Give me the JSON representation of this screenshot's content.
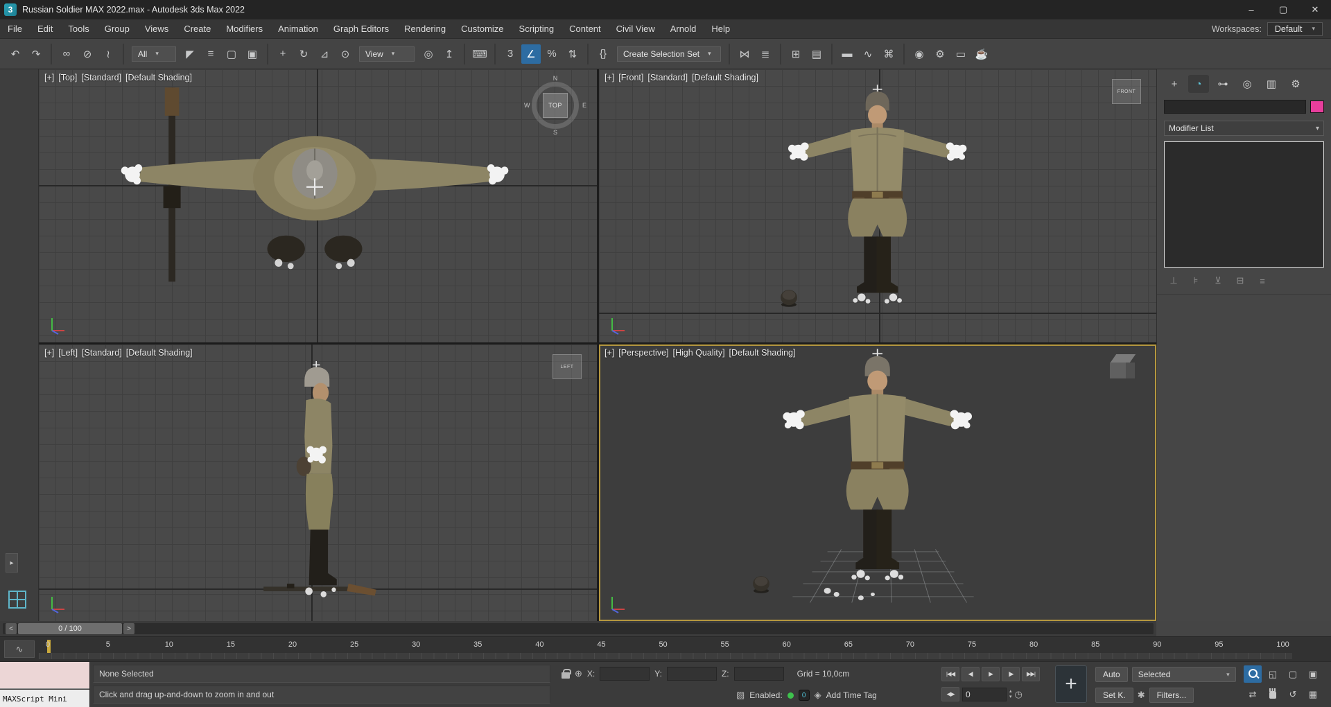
{
  "colors": {
    "active_viewport_border": "#b5973f",
    "active_tool_highlight": "#2d6ca2",
    "object_color_swatch": "#e83e9c",
    "enabled_dot": "#3ec14d",
    "layout_tab_icon": "#5fb6ca"
  },
  "titlebar": {
    "app_icon_text": "3",
    "title": "Russian Soldier MAX 2022.max - Autodesk 3ds Max 2022",
    "minimize": "–",
    "maximize": "▢",
    "close": "✕"
  },
  "menubar": {
    "items": [
      "File",
      "Edit",
      "Tools",
      "Group",
      "Views",
      "Create",
      "Modifiers",
      "Animation",
      "Graph Editors",
      "Rendering",
      "Customize",
      "Scripting",
      "Content",
      "Civil View",
      "Arnold",
      "Help"
    ],
    "workspaces_label": "Workspaces:",
    "workspaces_value": "Default",
    "workspaces_arrow": "▾"
  },
  "toolbar": {
    "group1": [
      {
        "name": "undo-button",
        "glyph": "↶",
        "state": "normal",
        "i": "true"
      },
      {
        "name": "redo-button",
        "glyph": "↷",
        "state": "normal",
        "i": "true"
      },
      {
        "name": "toolbar-separator",
        "glyph": "",
        "state": "sep",
        "i": "false"
      },
      {
        "name": "select-and-link-button",
        "glyph": "∞",
        "state": "normal",
        "i": "true"
      },
      {
        "name": "unlink-selection-button",
        "glyph": "⊘",
        "state": "normal",
        "i": "true"
      },
      {
        "name": "bind-to-space-warp-button",
        "glyph": "≀",
        "state": "normal",
        "i": "true"
      },
      {
        "name": "toolbar-separator",
        "glyph": "",
        "state": "sep",
        "i": "false"
      }
    ],
    "selection_filter_value": "All",
    "dropdown_arrow": "▾",
    "group2": [
      {
        "name": "select-object-button",
        "glyph": "◤",
        "state": "normal",
        "i": "true"
      },
      {
        "name": "select-by-name-button",
        "glyph": "≡",
        "state": "normal",
        "i": "true"
      },
      {
        "name": "rectangular-selection-region-button",
        "glyph": "▢",
        "state": "normal",
        "i": "true"
      },
      {
        "name": "window-crossing-toggle",
        "glyph": "▣",
        "state": "normal",
        "i": "true"
      },
      {
        "name": "toolbar-separator",
        "glyph": "",
        "state": "sep",
        "i": "false"
      },
      {
        "name": "select-and-move-button",
        "glyph": "+",
        "state": "normal",
        "i": "true"
      },
      {
        "name": "select-and-rotate-button",
        "glyph": "↻",
        "state": "normal",
        "i": "true"
      },
      {
        "name": "select-and-scale-button",
        "glyph": "⊿",
        "state": "normal",
        "i": "true"
      },
      {
        "name": "select-and-place-button",
        "glyph": "⊙",
        "state": "normal",
        "i": "true"
      }
    ],
    "coord_system_value": "View",
    "group3": [
      {
        "name": "use-pivot-point-button",
        "glyph": "◎",
        "state": "normal",
        "i": "true"
      },
      {
        "name": "select-and-manipulate-button",
        "glyph": "↥",
        "state": "normal",
        "i": "true"
      },
      {
        "name": "toolbar-separator",
        "glyph": "",
        "state": "sep",
        "i": "false"
      },
      {
        "name": "keyboard-shortcut-override-toggle",
        "glyph": "⌨",
        "state": "normal",
        "i": "true"
      },
      {
        "name": "toolbar-separator",
        "glyph": "",
        "state": "sep",
        "i": "false"
      },
      {
        "name": "snaps-toggle-3d",
        "glyph": "3",
        "state": "normal",
        "i": "true"
      },
      {
        "name": "angle-snap-toggle",
        "glyph": "∠",
        "state": "active",
        "i": "true"
      },
      {
        "name": "percent-snap-toggle",
        "glyph": "%",
        "state": "normal",
        "i": "true"
      },
      {
        "name": "spinner-snap-toggle",
        "glyph": "⇅",
        "state": "normal",
        "i": "true"
      },
      {
        "name": "toolbar-separator",
        "glyph": "",
        "state": "sep",
        "i": "false"
      },
      {
        "name": "edit-named-selection-sets-button",
        "glyph": "{}",
        "state": "normal",
        "i": "true"
      }
    ],
    "selection_set_value": "Create Selection Set",
    "group4": [
      {
        "name": "toolbar-separator",
        "glyph": "",
        "state": "sep",
        "i": "false"
      },
      {
        "name": "mirror-button",
        "glyph": "⋈",
        "state": "normal",
        "i": "true"
      },
      {
        "name": "align-button",
        "glyph": "≣",
        "state": "normal",
        "i": "true"
      },
      {
        "name": "toolbar-separator",
        "glyph": "",
        "state": "sep",
        "i": "false"
      },
      {
        "name": "toggle-scene-explorer-button",
        "glyph": "⊞",
        "state": "normal",
        "i": "true"
      },
      {
        "name": "toggle-layer-explorer-button",
        "glyph": "▤",
        "state": "normal",
        "i": "true"
      },
      {
        "name": "toolbar-separator",
        "glyph": "",
        "state": "sep",
        "i": "false"
      },
      {
        "name": "toggle-ribbon-button",
        "glyph": "▬",
        "state": "normal",
        "i": "true"
      },
      {
        "name": "curve-editor-button",
        "glyph": "∿",
        "state": "normal",
        "i": "true"
      },
      {
        "name": "schematic-view-button",
        "glyph": "⌘",
        "state": "normal",
        "i": "true"
      },
      {
        "name": "toolbar-separator",
        "glyph": "",
        "state": "sep",
        "i": "false"
      },
      {
        "name": "material-editor-button",
        "glyph": "◉",
        "state": "normal",
        "i": "true"
      },
      {
        "name": "render-setup-button",
        "glyph": "⚙",
        "state": "normal",
        "i": "true"
      },
      {
        "name": "rendered-frame-window-button",
        "glyph": "▭",
        "state": "normal",
        "i": "true"
      },
      {
        "name": "render-production-button",
        "glyph": "☕",
        "state": "normal",
        "i": "true"
      }
    ]
  },
  "left_strip": {
    "expand_arrow": "▸"
  },
  "viewports": {
    "top": {
      "menus": [
        "[+]",
        "[Top]",
        "[Standard]",
        "[Default Shading]"
      ],
      "viewcube": {
        "face": "TOP",
        "n": "N",
        "s": "S",
        "w": "W",
        "e": "E"
      }
    },
    "front": {
      "menus": [
        "[+]",
        "[Front]",
        "[Standard]",
        "[Default Shading]"
      ],
      "viewcube_face": "FRONT"
    },
    "left": {
      "menus": [
        "[+]",
        "[Left]",
        "[Standard]",
        "[Default Shading]"
      ],
      "viewcube_face": "LEFT"
    },
    "perspective": {
      "menus": [
        "[+]",
        "[Perspective]",
        "[High Quality]",
        "[Default Shading]"
      ]
    }
  },
  "command_panel": {
    "tabs": [
      {
        "name": "tab-create",
        "glyph": "+",
        "state": "normal",
        "i": "true"
      },
      {
        "name": "tab-modify",
        "glyph": "◔",
        "state": "active",
        "i": "true"
      },
      {
        "name": "tab-hierarchy",
        "glyph": "⊶",
        "state": "normal",
        "i": "true"
      },
      {
        "name": "tab-motion",
        "glyph": "◎",
        "state": "normal",
        "i": "true"
      },
      {
        "name": "tab-display",
        "glyph": "▥",
        "state": "normal",
        "i": "true"
      },
      {
        "name": "tab-utilities",
        "glyph": "⚙",
        "state": "normal",
        "i": "true"
      }
    ],
    "object_name_value": "",
    "modifier_list_label": "Modifier List",
    "dropdown_arrow": "▾",
    "stack_buttons": [
      {
        "name": "pin-stack-button",
        "glyph": "⊥",
        "i": "true"
      },
      {
        "name": "show-end-result-button",
        "glyph": "⊧",
        "i": "true"
      },
      {
        "name": "make-unique-button",
        "glyph": "⊻",
        "i": "true"
      },
      {
        "name": "remove-modifier-button",
        "glyph": "⊟",
        "i": "true"
      },
      {
        "name": "configure-modifier-sets-button",
        "glyph": "≡",
        "i": "true"
      }
    ]
  },
  "timeline": {
    "slider_back": "<",
    "slider_forward": ">",
    "slider_label": "0 / 100",
    "mini_curve_glyph": "∿",
    "ticks": [
      "0",
      "5",
      "10",
      "15",
      "20",
      "25",
      "30",
      "35",
      "40",
      "45",
      "50",
      "55",
      "60",
      "65",
      "70",
      "75",
      "80",
      "85",
      "90",
      "95",
      "100"
    ]
  },
  "status_bar": {
    "maxscript_label": "MAXScript Mini",
    "status_line": "None Selected",
    "prompt_line": "Click and drag up-and-down to zoom in and out",
    "absolute_mode_glyph": "⊕",
    "x_label": "X:",
    "y_label": "Y:",
    "z_label": "Z:",
    "coord_x_value": "",
    "coord_y_value": "",
    "coord_z_value": "",
    "grid_text": "Grid = 10,0cm",
    "degradation_glyph": "▧",
    "enabled_label": "Enabled:",
    "zero_badge": "0",
    "time_tag_glyph": "◈",
    "add_time_tag_label": "Add Time Tag",
    "playback": [
      {
        "name": "go-to-start-button",
        "glyph": "|◀◀"
      },
      {
        "name": "previous-frame-button",
        "glyph": "◀|"
      },
      {
        "name": "play-button",
        "glyph": "▶"
      },
      {
        "name": "next-frame-button",
        "glyph": "|▶"
      },
      {
        "name": "go-to-end-button",
        "glyph": "▶▶|"
      }
    ],
    "prev_next_key_glyph": "◀▶",
    "time_value": "0",
    "spinner_up": "▴",
    "spinner_down": "▾",
    "key_mode_glyph": "◷",
    "set_keys_plus": "+",
    "auto_key_label": "Auto",
    "selected_dropdown_value": "Selected",
    "dropdown_arrow": "▾",
    "set_key_label": "Set K.",
    "key_filters_glyph": "✱",
    "filters_label": "Filters...",
    "nav_row1": [
      {
        "name": "zoom-button",
        "glyph": "",
        "state": "magnifier-active"
      },
      {
        "name": "zoom-all-button",
        "glyph": "◱",
        "state": "normal"
      },
      {
        "name": "zoom-extents-button",
        "glyph": "▢",
        "state": "normal"
      },
      {
        "name": "zoom-extents-all-button",
        "glyph": "▣",
        "state": "normal"
      }
    ],
    "nav_row2": [
      {
        "name": "zoom-region-button",
        "glyph": "⇄",
        "state": "normal"
      },
      {
        "name": "pan-button",
        "glyph": "",
        "state": "hand"
      },
      {
        "name": "orbit-button",
        "glyph": "↺",
        "state": "normal"
      },
      {
        "name": "maximize-viewport-button",
        "glyph": "▦",
        "state": "normal"
      }
    ]
  }
}
